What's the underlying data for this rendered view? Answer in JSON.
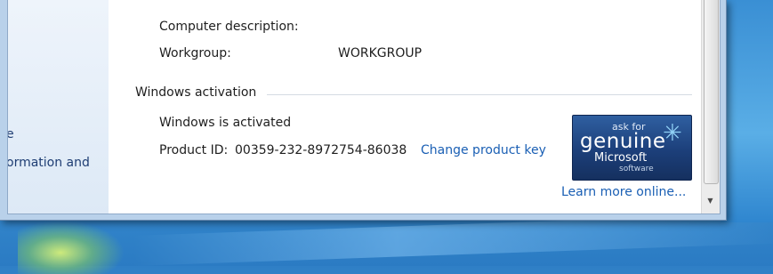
{
  "left_pane": {
    "line1": "e",
    "line2": "ormation and"
  },
  "computer": {
    "description_label": "Computer description:",
    "workgroup_label": "Workgroup:",
    "workgroup_value": "WORKGROUP"
  },
  "activation": {
    "section_title": "Windows activation",
    "status": "Windows is activated",
    "product_id_label": "Product ID:",
    "product_id_value": "00359-232-8972754-86038",
    "change_key_link": "Change product key",
    "learn_more_link": "Learn more online..."
  },
  "badge": {
    "ask": "ask for",
    "genuine": "genuine",
    "microsoft": "Microsoft",
    "software": "software"
  },
  "icons": {
    "scroll_down": "scroll-down-arrow-icon",
    "genuine_star": "genuine-star-icon"
  }
}
